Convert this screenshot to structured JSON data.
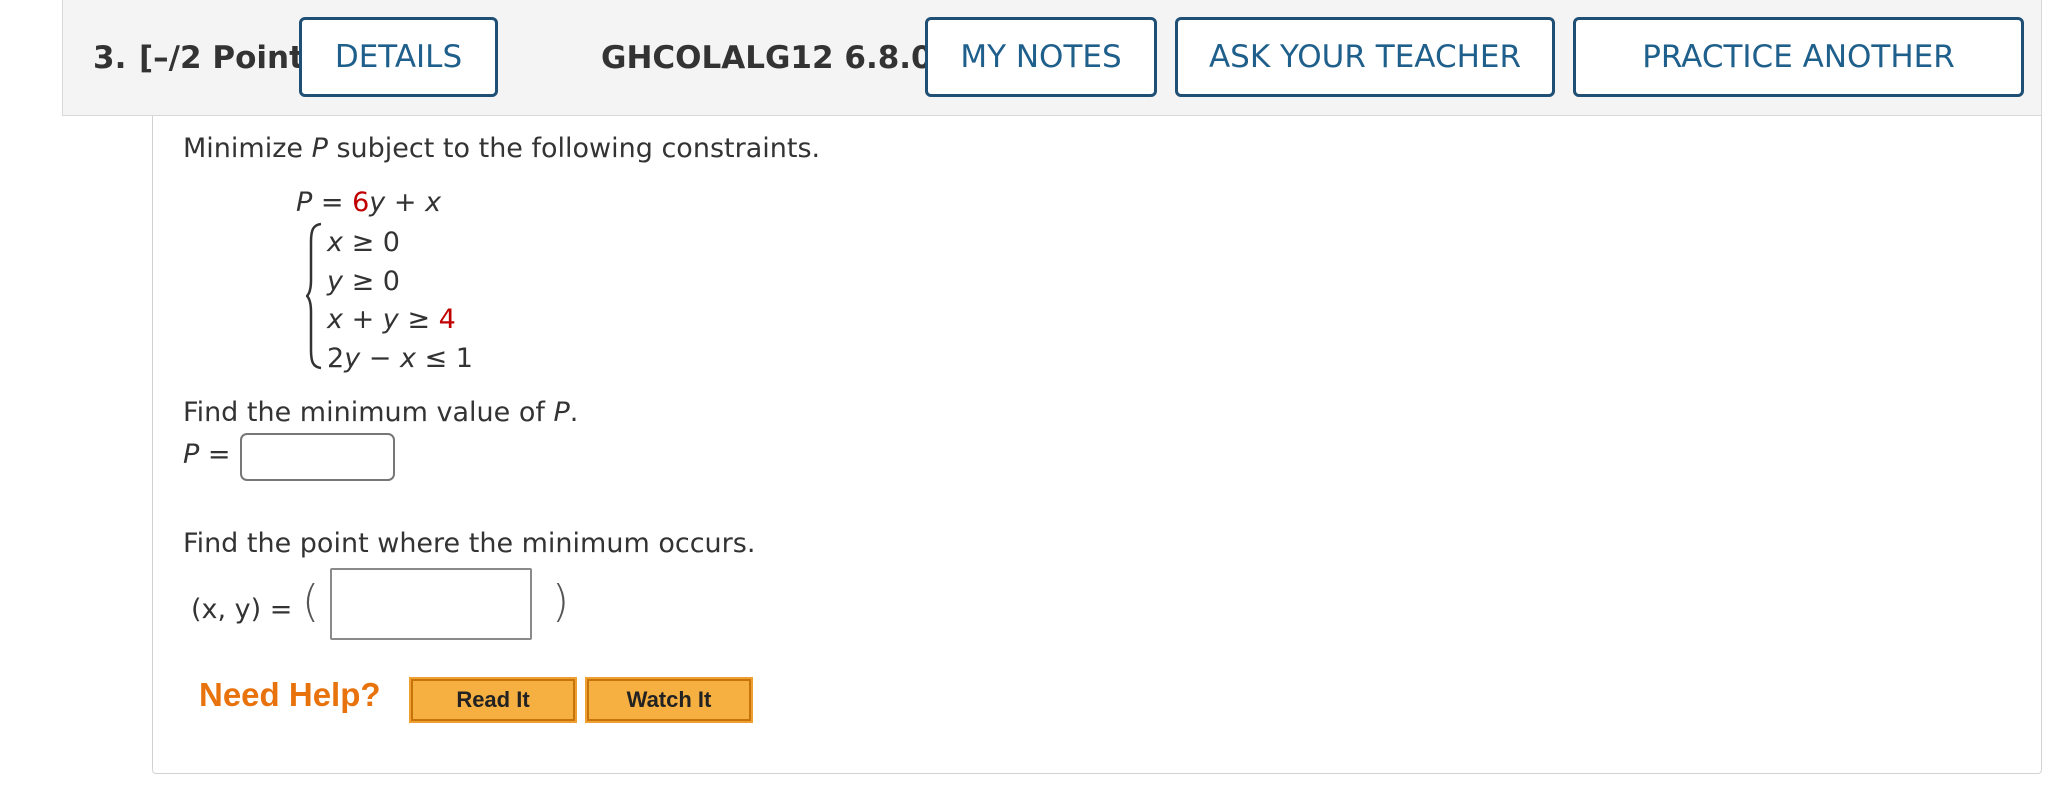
{
  "header": {
    "question_number": "3.",
    "points": "[–/2 Points]",
    "details_label": "DETAILS",
    "question_id": "GHCOLALG12 6.8.016.",
    "my_notes_label": "MY NOTES",
    "ask_teacher_label": "ASK YOUR TEACHER",
    "practice_label": "PRACTICE ANOTHER"
  },
  "problem": {
    "intro_pre": "Minimize ",
    "intro_var": "P",
    "intro_post": " subject to the following constraints.",
    "objective": {
      "lhs": "P",
      "eq": " = ",
      "coef": "6",
      "rest_var_y": "y",
      "plus": " + ",
      "var_x": "x"
    },
    "constraints": [
      {
        "a": "x",
        "b": " ≥ 0"
      },
      {
        "a": "y",
        "b": " ≥ 0"
      },
      {
        "a": "x",
        "mid": " + ",
        "c": "y",
        "b": " ≥ ",
        "red": "4"
      },
      {
        "pre": "2",
        "a": "y",
        "mid": " − ",
        "c": "x",
        "b": " ≤ 1"
      }
    ],
    "find_min_pre": "Find the minimum value of ",
    "find_min_var": "P",
    "find_min_post": ".",
    "p_label_var": "P",
    "p_label_eq": " = ",
    "p_value": "",
    "find_point": "Find the point where the minimum occurs.",
    "xy_label": "(x, y) =",
    "xy_open": "(",
    "xy_close": ")",
    "xy_value": ""
  },
  "help": {
    "need_help": "Need Help?",
    "read_it": "Read It",
    "watch_it": "Watch It"
  },
  "colors": {
    "button_border": "#1f4f75",
    "button_text": "#1f5f8b",
    "highlight_red": "#c00000",
    "need_help_orange": "#e8720c",
    "help_button_fill": "#f6b042"
  }
}
